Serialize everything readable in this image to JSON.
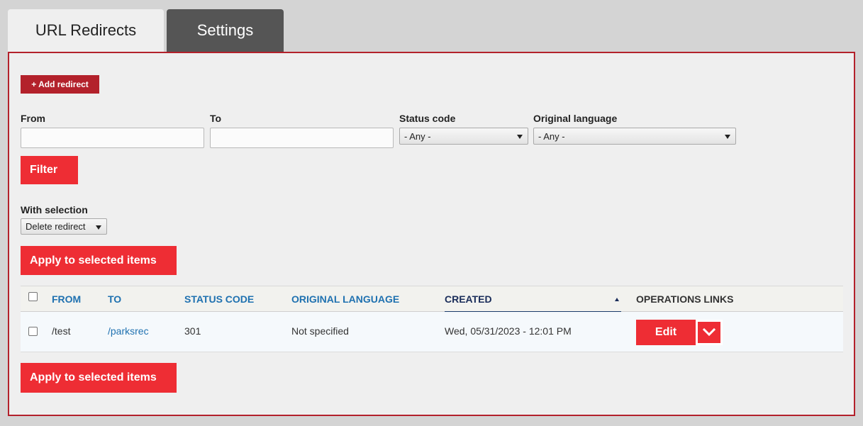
{
  "tabs": [
    {
      "label": "URL Redirects"
    },
    {
      "label": "Settings"
    }
  ],
  "toolbar": {
    "add_label": "+ Add redirect"
  },
  "filters": {
    "from": {
      "label": "From",
      "value": "",
      "placeholder": ""
    },
    "to": {
      "label": "To",
      "value": "",
      "placeholder": ""
    },
    "status_code": {
      "label": "Status code",
      "selected": "- Any -"
    },
    "original_language": {
      "label": "Original language",
      "selected": "- Any -"
    },
    "filter_button": "Filter"
  },
  "bulk": {
    "label": "With selection",
    "selected": "Delete redirect",
    "apply_label": "Apply to selected items"
  },
  "table": {
    "columns": [
      "From",
      "To",
      "Status code",
      "Original language",
      "Created",
      "Operations links"
    ],
    "rows": [
      {
        "from": "/test",
        "to": "/parksrec",
        "status_code": "301",
        "original_language": "Not specified",
        "created": "Wed, 05/31/2023 - 12:01 PM",
        "operation": "Edit"
      }
    ]
  },
  "colors": {
    "brand_red": "#b3212b",
    "button_red": "#ee2d34",
    "link_blue": "#1f71b0"
  },
  "icons": {
    "sort": "sort-ascending-icon",
    "dropdown": "chevron-down-icon"
  }
}
